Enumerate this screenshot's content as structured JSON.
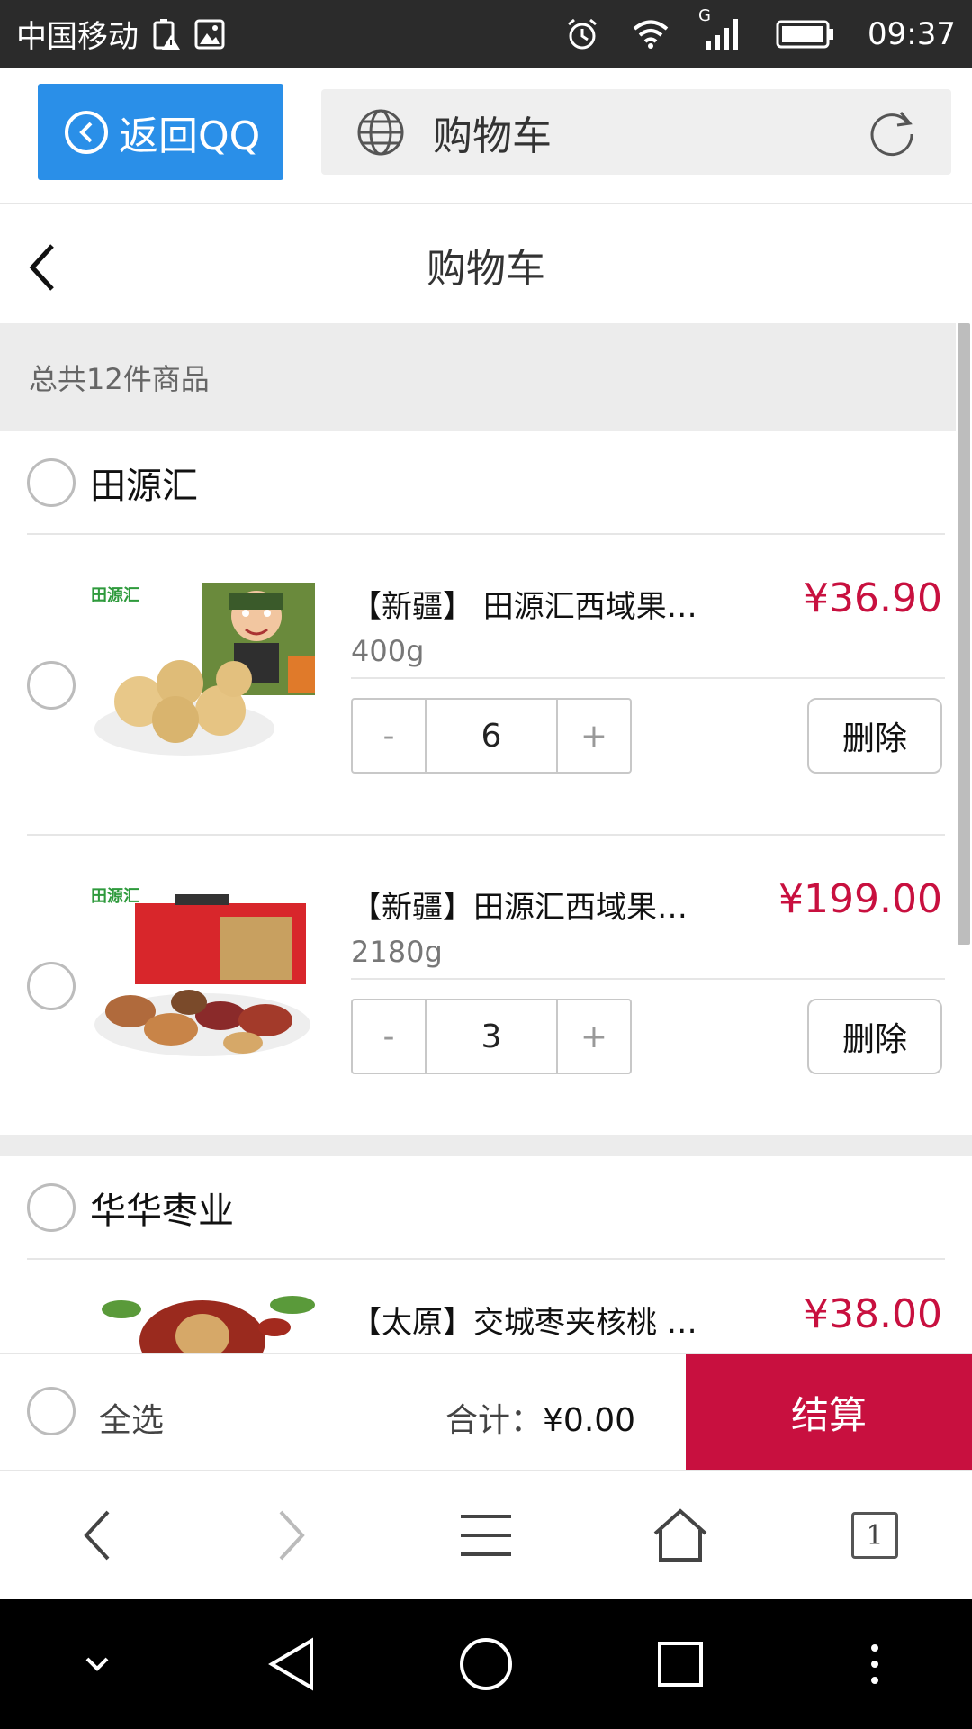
{
  "status_bar": {
    "carrier": "中国移动",
    "network_type": "G",
    "time": "09:37"
  },
  "browser": {
    "back_label": "返回QQ",
    "url_title": "购物车",
    "tab_count": "1"
  },
  "page": {
    "title": "购物车",
    "summary": "总共12件商品"
  },
  "shops": [
    {
      "name": "田源汇",
      "items": [
        {
          "name": "【新疆】 田源汇西域果…",
          "spec": "400g",
          "price": "¥36.90",
          "qty": "6",
          "delete_label": "删除",
          "image_label": "田源汇"
        },
        {
          "name": "【新疆】田源汇西域果…",
          "spec": "2180g",
          "price": "¥199.00",
          "qty": "3",
          "delete_label": "删除",
          "image_label": "田源汇"
        }
      ]
    },
    {
      "name": "华华枣业",
      "items": [
        {
          "name": "【太原】交城枣夹核桃 …",
          "price": "¥38.00"
        }
      ]
    }
  ],
  "stepper": {
    "minus": "-",
    "plus": "+"
  },
  "checkout": {
    "select_all": "全选",
    "total_label": "合计：",
    "total_amount": "¥0.00",
    "pay_label": "结算"
  },
  "colors": {
    "accent_blue": "#2a8fe8",
    "price_red": "#c8103f",
    "checkout_red": "#c8103f"
  }
}
